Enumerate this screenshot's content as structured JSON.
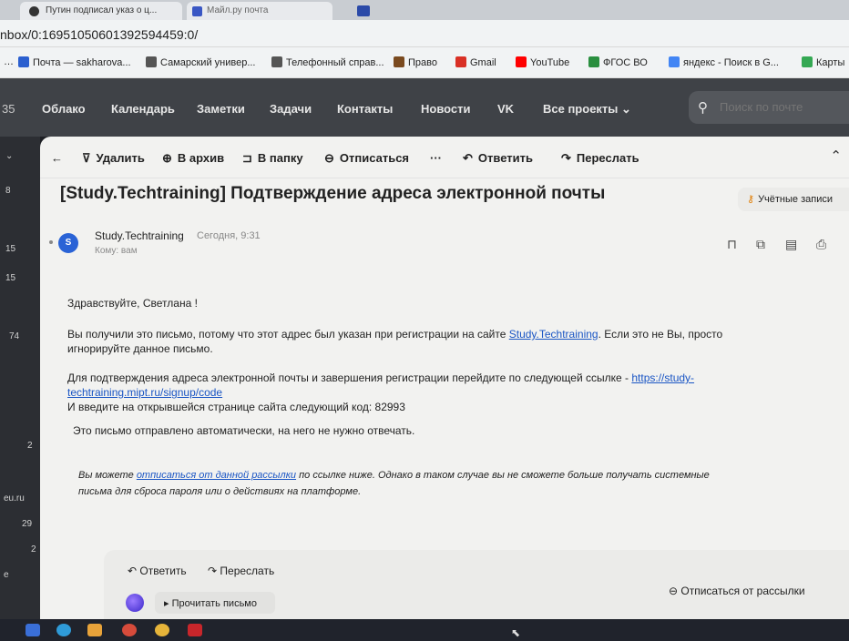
{
  "browser": {
    "tabs": [
      {
        "label": "Путин подписал указ о ц..."
      },
      {
        "label": "Майл.ру почта"
      }
    ],
    "url": "nbox/0:16951050601392594459:0/",
    "bookmarks": [
      {
        "label": "Почта — sakharova...",
        "icon_color": "#2b5fcf"
      },
      {
        "label": "Самарский универ...",
        "icon_color": "#555555"
      },
      {
        "label": "Телефонный справ...",
        "icon_color": "#555555"
      },
      {
        "label": "Право",
        "icon_color": "#7a4a1f"
      },
      {
        "label": "Gmail",
        "icon_color": "#d93025"
      },
      {
        "label": "YouTube",
        "icon_color": "#ff0000"
      },
      {
        "label": "ФГОС ВО",
        "icon_color": "#2a8f3f"
      },
      {
        "label": "яндекс - Поиск в G...",
        "icon_color": "#4285f4"
      },
      {
        "label": "Карты",
        "icon_color": "#34a853"
      }
    ]
  },
  "mail_nav": {
    "unread_count": "35",
    "items": [
      "Облако",
      "Календарь",
      "Заметки",
      "Задачи",
      "Контакты",
      "Новости",
      "VK",
      "Все проекты ⌄"
    ],
    "search_placeholder": "Поиск по почте"
  },
  "left_strip": {
    "numbers": [
      "8",
      "15",
      "15",
      "74",
      "2",
      "eu.ru",
      "29",
      "2",
      "e"
    ]
  },
  "toolbar": {
    "back": "←",
    "delete": "Удалить",
    "archive": "В архив",
    "move": "В папку",
    "unsubscribe": "Отписаться",
    "more": "···",
    "reply": "Ответить",
    "forward": "Переслать"
  },
  "message": {
    "subject": "[Study.Techtraining] Подтверждение адреса электронной почты",
    "accounts_button": "Учётные записи",
    "avatar_letter": "S",
    "sender": "Study.Techtraining",
    "date": "Сегодня, 9:31",
    "to": "Кому: вам",
    "greeting": "Здравствуйте, Светлана !",
    "p1_a": "Вы получили это письмо, потому что этот адрес был указан при регистрации на сайте ",
    "p1_link": "Study.Techtraining",
    "p1_b": ". Если это не Вы, просто",
    "p1_c": "игнорируйте данное письмо.",
    "p2_a": "Для подтверждения адреса электронной почты и завершения регистрации перейдите по следующей ссылке - ",
    "p2_link_a": "https://study-",
    "p2_link_b": "techtraining.mipt.ru/signup/code",
    "p2_c": "И введите на открывшейся странице сайта следующий код: 82993",
    "p3": "Это письмо отправлено автоматически, на него не нужно отвечать.",
    "p4_a": "Вы можете ",
    "p4_link": "отписаться от данной рассылки",
    "p4_b": " по ссылке ниже. Однако в таком случае вы не сможете больше получать системные",
    "p4_c": "письма для сброса пароля или о действиях на платформе."
  },
  "reply_bar": {
    "reply": "Ответить",
    "forward": "Переслать",
    "read_button": "Прочитать письмо",
    "unsubscribe": "Отписаться от рассылки"
  }
}
